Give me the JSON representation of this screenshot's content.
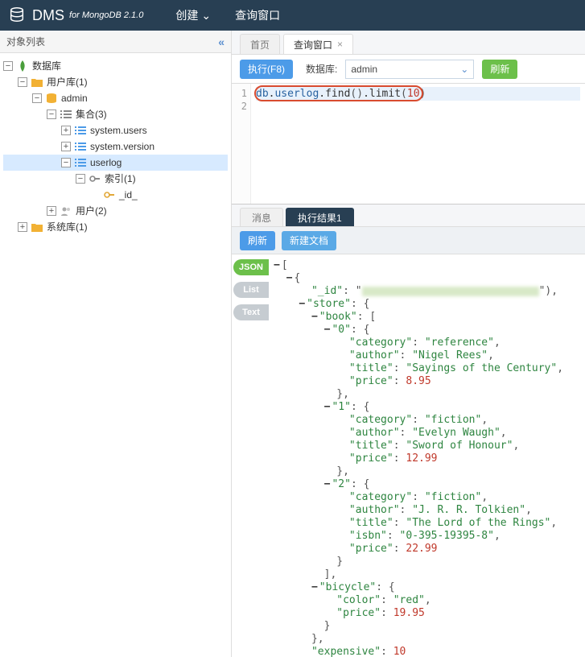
{
  "header": {
    "app_name": "DMS",
    "app_sub": "for MongoDB 2.1.0",
    "menu_create": "创建",
    "menu_query": "查询窗口"
  },
  "sidebar": {
    "title": "对象列表",
    "root_label": "数据库",
    "userdb_label": "用户库(1)",
    "admin_label": "admin",
    "collections_label": "集合(3)",
    "coll_users": "system.users",
    "coll_version": "system.version",
    "coll_userlog": "userlog",
    "index_label": "索引(1)",
    "index_id": "_id_",
    "users_label": "用户(2)",
    "sysdb_label": "系统库(1)"
  },
  "tabs": {
    "home": "首页",
    "query": "查询窗口"
  },
  "toolbar": {
    "execute": "执行(F8)",
    "db_label": "数据库:",
    "db_value": "admin",
    "refresh": "刷新"
  },
  "editor": {
    "line1_obj": "db",
    "line1_dot1": ".",
    "line1_coll": "userlog",
    "line1_dot2": ".",
    "line1_find": "find",
    "line1_par1": "()",
    "line1_dot3": ".",
    "line1_limit": "limit",
    "line1_p2o": "(",
    "line1_num": "10",
    "line1_p2c": ")"
  },
  "result_tabs": {
    "msg": "消息",
    "result1": "执行结果1"
  },
  "result_toolbar": {
    "refresh": "刷新",
    "newdoc": "新建文档"
  },
  "view_tabs": {
    "json": "JSON",
    "list": "List",
    "text": "Text"
  },
  "doc": {
    "id_key": "\"_id\"",
    "store_key": "\"store\"",
    "book_key": "\"book\"",
    "category_key": "\"category\"",
    "author_key": "\"author\"",
    "title_key": "\"title\"",
    "price_key": "\"price\"",
    "isbn_key": "\"isbn\"",
    "bicycle_key": "\"bicycle\"",
    "color_key": "\"color\"",
    "expensive_key": "\"expensive\"",
    "b0_cat": "\"reference\"",
    "b0_auth": "\"Nigel Rees\"",
    "b0_title": "\"Sayings of the Century\"",
    "b0_price": "8.95",
    "b1_cat": "\"fiction\"",
    "b1_auth": "\"Evelyn Waugh\"",
    "b1_title": "\"Sword of Honour\"",
    "b1_price": "12.99",
    "b2_cat": "\"fiction\"",
    "b2_auth": "\"J. R. R. Tolkien\"",
    "b2_title": "\"The Lord of the Rings\"",
    "b2_isbn": "\"0-395-19395-8\"",
    "b2_price": "22.99",
    "bike_color": "\"red\"",
    "bike_price": "19.95",
    "expensive_val": "10"
  }
}
